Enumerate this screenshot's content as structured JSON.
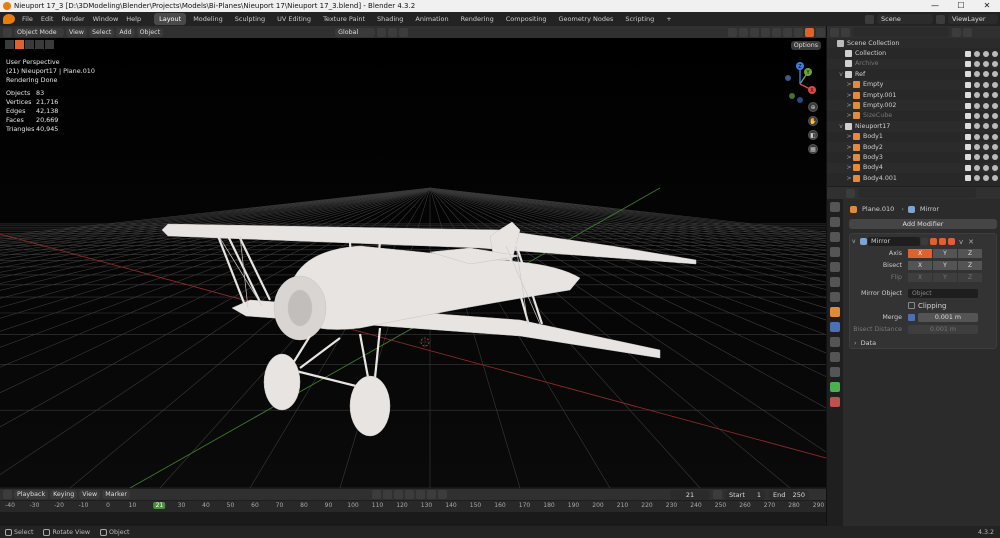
{
  "window": {
    "title": "Nieuport 17_3 [D:\\3DModeling\\Blender\\Projects\\Models\\Bi-Planes\\Nieuport 17\\Nieuport 17_3.blend] - Blender 4.3.2",
    "controls": [
      "—",
      "☐",
      "✕"
    ]
  },
  "menu": [
    "File",
    "Edit",
    "Render",
    "Window",
    "Help"
  ],
  "workspaces": [
    {
      "label": "Layout",
      "active": true
    },
    {
      "label": "Modeling"
    },
    {
      "label": "Sculpting"
    },
    {
      "label": "UV Editing"
    },
    {
      "label": "Texture Paint"
    },
    {
      "label": "Shading"
    },
    {
      "label": "Animation"
    },
    {
      "label": "Rendering"
    },
    {
      "label": "Compositing"
    },
    {
      "label": "Geometry Nodes"
    },
    {
      "label": "Scripting"
    },
    {
      "label": "+"
    }
  ],
  "topright": {
    "scene": "Scene",
    "view_layer": "ViewLayer"
  },
  "viewport_header": {
    "mode": "Object Mode",
    "menus": [
      "View",
      "Select",
      "Add",
      "Object"
    ],
    "transform_orientation": "Global",
    "options": "Options"
  },
  "overlay_text": {
    "line1": "User Perspective",
    "line2": "(21) Nieuport17 | Plane.010",
    "line3": "Rendering Done",
    "stats": [
      {
        "k": "Objects",
        "v": "83"
      },
      {
        "k": "Vertices",
        "v": "21,716"
      },
      {
        "k": "Edges",
        "v": "42,138"
      },
      {
        "k": "Faces",
        "v": "20,669"
      },
      {
        "k": "Triangles",
        "v": "40,945"
      }
    ]
  },
  "gizmo": {
    "x": "X",
    "y": "Y",
    "z": "Z"
  },
  "outliner": {
    "search_placeholder": "",
    "rows": [
      {
        "label": "Scene Collection",
        "indent": 0,
        "icon_color": "#bbbbbb",
        "exp": ""
      },
      {
        "label": "Collection",
        "indent": 1,
        "icon_color": "#d0d0d0",
        "exp": ""
      },
      {
        "label": "Archive",
        "indent": 1,
        "icon_color": "#d0d0d0",
        "exp": "",
        "dim": true
      },
      {
        "label": "Ref",
        "indent": 1,
        "icon_color": "#d0d0d0",
        "exp": "v"
      },
      {
        "label": "Empty",
        "indent": 2,
        "icon_color": "#e58a3a",
        "exp": ">"
      },
      {
        "label": "Empty.001",
        "indent": 2,
        "icon_color": "#e58a3a",
        "exp": ">"
      },
      {
        "label": "Empty.002",
        "indent": 2,
        "icon_color": "#e58a3a",
        "exp": ">"
      },
      {
        "label": "SizeCube",
        "indent": 2,
        "icon_color": "#e58a3a",
        "exp": ">",
        "dim": true
      },
      {
        "label": "Nieuport17",
        "indent": 1,
        "icon_color": "#d0d0d0",
        "exp": "v"
      },
      {
        "label": "Body1",
        "indent": 2,
        "icon_color": "#e58a3a",
        "exp": ">"
      },
      {
        "label": "Body2",
        "indent": 2,
        "icon_color": "#e58a3a",
        "exp": ">"
      },
      {
        "label": "Body3",
        "indent": 2,
        "icon_color": "#e58a3a",
        "exp": ">"
      },
      {
        "label": "Body4",
        "indent": 2,
        "icon_color": "#e58a3a",
        "exp": ">"
      },
      {
        "label": "Body4.001",
        "indent": 2,
        "icon_color": "#e58a3a",
        "exp": ">"
      }
    ]
  },
  "properties": {
    "object_name": "Plane.010",
    "modifier_crumb": "Mirror",
    "add_modifier": "Add Modifier",
    "modifier_name": "Mirror",
    "axis_label": "Axis",
    "bisect_label": "Bisect",
    "flip_label": "Flip",
    "axes": [
      "X",
      "Y",
      "Z"
    ],
    "mirror_object_label": "Mirror Object",
    "mirror_object_placeholder": "Object",
    "clipping_label": "Clipping",
    "merge_label": "Merge",
    "merge_value": "0.001 m",
    "bisect_distance_label": "Bisect Distance",
    "bisect_distance_value": "0.001 m",
    "data_label": "Data"
  },
  "timeline": {
    "menus": [
      "Playback",
      "Keying",
      "View",
      "Marker"
    ],
    "current_frame": "21",
    "start_label": "Start",
    "start": "1",
    "end_label": "End",
    "end": "250",
    "ticks": [
      "-40",
      "-30",
      "-20",
      "-10",
      "0",
      "10",
      "20",
      "30",
      "40",
      "50",
      "60",
      "70",
      "80",
      "90",
      "100",
      "110",
      "120",
      "130",
      "140",
      "150",
      "160",
      "170",
      "180",
      "190",
      "200",
      "210",
      "220",
      "230",
      "240",
      "250",
      "260",
      "270",
      "280",
      "290"
    ],
    "current_tick": "21"
  },
  "status": {
    "select": "Select",
    "rotate": "Rotate View",
    "object": "Object",
    "version": "4.3.2"
  },
  "colors": {
    "accent": "#e06030",
    "active_blue": "#4772b3",
    "frame_green": "#4a8f3a"
  }
}
